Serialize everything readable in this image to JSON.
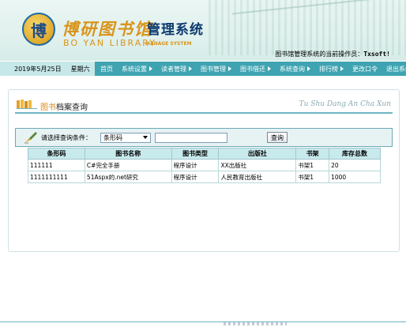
{
  "header": {
    "logo_char": "博",
    "logo_cn": "博研图书馆",
    "system_name": "管理系统",
    "logo_en": "BO YAN LIBRARY",
    "logo_sub": "MANAGE SYSTEM",
    "operator_label": "图书馆管理系统的当前操作员：",
    "operator_name": "Txsoft!"
  },
  "navbar": {
    "date": "2019年5月25日",
    "weekday": "星期六",
    "menu": [
      {
        "label": "首页",
        "arrow": false
      },
      {
        "label": "系统设置",
        "arrow": true
      },
      {
        "label": "读者管理",
        "arrow": true
      },
      {
        "label": "图书管理",
        "arrow": true
      },
      {
        "label": "图书借还",
        "arrow": true
      },
      {
        "label": "系统查询",
        "arrow": true
      },
      {
        "label": "排行榜",
        "arrow": true
      },
      {
        "label": "更改口令",
        "arrow": false
      },
      {
        "label": "退出系统",
        "arrow": false
      }
    ]
  },
  "panel": {
    "title_highlight": "图书",
    "title_rest": "档案查询",
    "title_en": "Tu Shu Dang An Cha Xun"
  },
  "search": {
    "label": "请选择查询条件：",
    "select_value": "条形码",
    "input_value": "",
    "button_label": "查询"
  },
  "table": {
    "headers": [
      "条形码",
      "图书名称",
      "图书类型",
      "出版社",
      "书架",
      "库存总数"
    ],
    "rows": [
      [
        "111111",
        "C#完全手册",
        "程序设计",
        "XX出版社",
        "书架1",
        "20"
      ],
      [
        "1111111111",
        "51Aspx的.net研究",
        "程序设计",
        "人民教育出版社",
        "书架1",
        "1000"
      ]
    ]
  },
  "colors": {
    "nav_bg": "#3fa3b1",
    "date_bg": "#c7e8e9",
    "header_bg": "#c9eaed",
    "accent_orange": "#e08a1a"
  }
}
